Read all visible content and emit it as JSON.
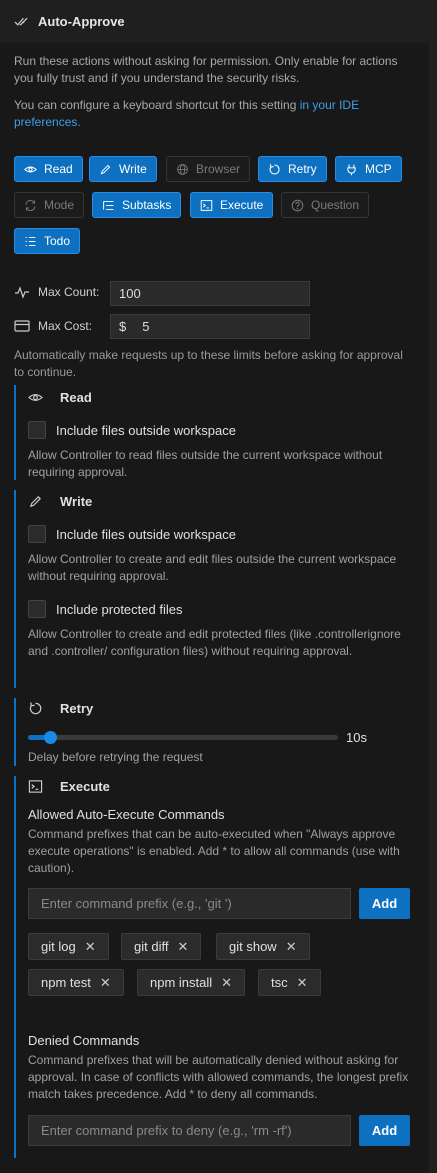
{
  "header": {
    "title": "Auto-Approve"
  },
  "intro": {
    "text": "Run these actions without asking for permission. Only enable for actions you fully trust and if you understand the security risks.",
    "shortcut_text": "You can configure a keyboard shortcut for this setting ",
    "shortcut_link": "in your IDE preferences."
  },
  "toggles": [
    {
      "label": "Read",
      "on": true
    },
    {
      "label": "Write",
      "on": true
    },
    {
      "label": "Browser",
      "on": false
    },
    {
      "label": "Retry",
      "on": true
    },
    {
      "label": "MCP",
      "on": true
    },
    {
      "label": "Mode",
      "on": false
    },
    {
      "label": "Subtasks",
      "on": true
    },
    {
      "label": "Execute",
      "on": true
    },
    {
      "label": "Question",
      "on": false
    },
    {
      "label": "Todo",
      "on": true
    }
  ],
  "limits": {
    "max_count_label": "Max Count:",
    "max_count_value": "100",
    "max_cost_label": "Max Cost:",
    "currency": "$",
    "max_cost_value": "5",
    "note": "Automatically make requests up to these limits before asking for approval to continue."
  },
  "read": {
    "title": "Read",
    "opt1_label": "Include files outside workspace",
    "opt1_desc": "Allow Controller to read files outside the current workspace without requiring approval."
  },
  "write": {
    "title": "Write",
    "opt1_label": "Include files outside workspace",
    "opt1_desc": "Allow Controller to create and edit files outside the current workspace without requiring approval.",
    "opt2_label": "Include protected files",
    "opt2_desc": "Allow Controller to create and edit protected files (like .controllerignore and .controller/ configuration files) without requiring approval."
  },
  "retry": {
    "title": "Retry",
    "value": "10s",
    "level": 0.07,
    "desc": "Delay before retrying the request"
  },
  "execute": {
    "title": "Execute",
    "allowed_title": "Allowed Auto-Execute Commands",
    "allowed_desc": "Command prefixes that can be auto-executed when \"Always approve execute operations\" is enabled. Add * to allow all commands (use with caution).",
    "allowed_placeholder": "Enter command prefix (e.g., 'git ')",
    "add_label": "Add",
    "allowed_commands": [
      "git log",
      "git diff",
      "git show",
      "npm test",
      "npm install",
      "tsc"
    ],
    "remove_glyph": "✕",
    "denied_title": "Denied Commands",
    "denied_desc": "Command prefixes that will be automatically denied without asking for approval. In case of conflicts with allowed commands, the longest prefix match takes precedence. Add * to deny all commands.",
    "denied_placeholder": "Enter command prefix to deny (e.g., 'rm -rf')",
    "denied_add_label": "Add"
  },
  "colors": {
    "accent": "#0e70c0",
    "link": "#3d9fe6",
    "background": "#181818"
  }
}
